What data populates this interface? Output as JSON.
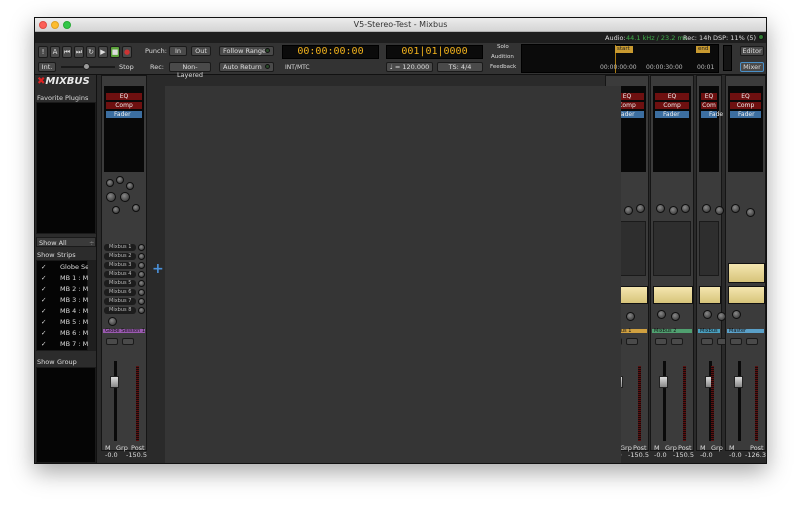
{
  "window": {
    "title": "V5-Stereo-Test - Mixbus"
  },
  "status": {
    "audio_label": "Audio:",
    "audio_value": "44.1 kHz / 23.2 ms",
    "rec_text": "Rec: 14h",
    "dsp_text": "DSP: 11% (5)"
  },
  "toolbar": {
    "transport_icons": [
      "!",
      "A",
      "⏮",
      "⏭",
      "↻",
      "▶",
      "■",
      "●"
    ],
    "int_label": "Int.",
    "stop_label": "Stop",
    "punch_label": "Punch:",
    "punch_in": "In",
    "punch_out": "Out",
    "rec_label": "Rec:",
    "rec_mode": "Non-Layered",
    "follow_range": "Follow Range",
    "auto_return": "Auto Return",
    "primary_clock": "00:00:00:00",
    "sync_source": "INT/MTC",
    "secondary_clock": "001|01|0000",
    "tempo": "♩ = 120.000",
    "meter": "TS: 4/4",
    "solo": "Solo",
    "audition": "Audition",
    "feedback": "Feedback",
    "mini_start": "start",
    "mini_end": "end",
    "mini_times": [
      "00:00:00:00",
      "00:00:30:00",
      "00:01"
    ],
    "editor_button": "Editor",
    "mixer_button": "Mixer"
  },
  "left_panel": {
    "logo": "MIXBUS",
    "favorite_plugins": "Favorite Plugins",
    "show_all": "Show All",
    "strips_header": {
      "show": "Show",
      "strips": "Strips"
    },
    "strips": [
      {
        "checked": "✓",
        "name": "Globe Se"
      },
      {
        "checked": "✓",
        "name": "MB 1 : M"
      },
      {
        "checked": "✓",
        "name": "MB 2 : M"
      },
      {
        "checked": "✓",
        "name": "MB 3 : M"
      },
      {
        "checked": "✓",
        "name": "MB 4 : M"
      },
      {
        "checked": "✓",
        "name": "MB 5 : M"
      },
      {
        "checked": "✓",
        "name": "MB 6 : M"
      },
      {
        "checked": "✓",
        "name": "MB 7 : M"
      }
    ],
    "group_header": {
      "show": "Show",
      "group": "Group"
    }
  },
  "input_strip": {
    "plugins": [
      "EQ",
      "Comp",
      "Fader"
    ],
    "buses": [
      "Mixbus 1",
      "Mixbus 2",
      "Mixbus 3",
      "Mixbus 4",
      "Mixbus 5",
      "Mixbus 6",
      "Mixbus 7",
      "Mixbus 8"
    ],
    "name": "Globe Session 1",
    "gain": "-0.0",
    "peak": "-150.5",
    "m": "M",
    "grp": "Grp",
    "post": "Post",
    "color": "#9a5ab0"
  },
  "add_strip_icon": "+",
  "mix_strips": [
    {
      "plugins": [
        "EQ",
        "Comp",
        "Fader"
      ],
      "name": "Mixbus 1",
      "gain": "-0.0",
      "peak": "-150.5",
      "m": "M",
      "grp": "Grp",
      "post": "Post",
      "color": "#d0a040"
    },
    {
      "plugins": [
        "EQ",
        "Comp",
        "Fader"
      ],
      "name": "Mixbus 2",
      "gain": "-0.0",
      "peak": "-150.5",
      "m": "M",
      "grp": "Grp",
      "post": "Post",
      "color": "#50a070"
    },
    {
      "plugins": [
        "EQ",
        "Com",
        "Fade"
      ],
      "name": "Mixbus",
      "gain": "-0.0",
      "peak": "-",
      "m": "M",
      "grp": "Grp",
      "post": "",
      "color": "#4aa0c0"
    }
  ],
  "master_strip": {
    "plugins": [
      "EQ",
      "Comp",
      "Fader"
    ],
    "name": "Master",
    "gain": "-0.0",
    "peak": "-126.3",
    "m": "M",
    "post": "Post",
    "color": "#5aa0c8"
  }
}
